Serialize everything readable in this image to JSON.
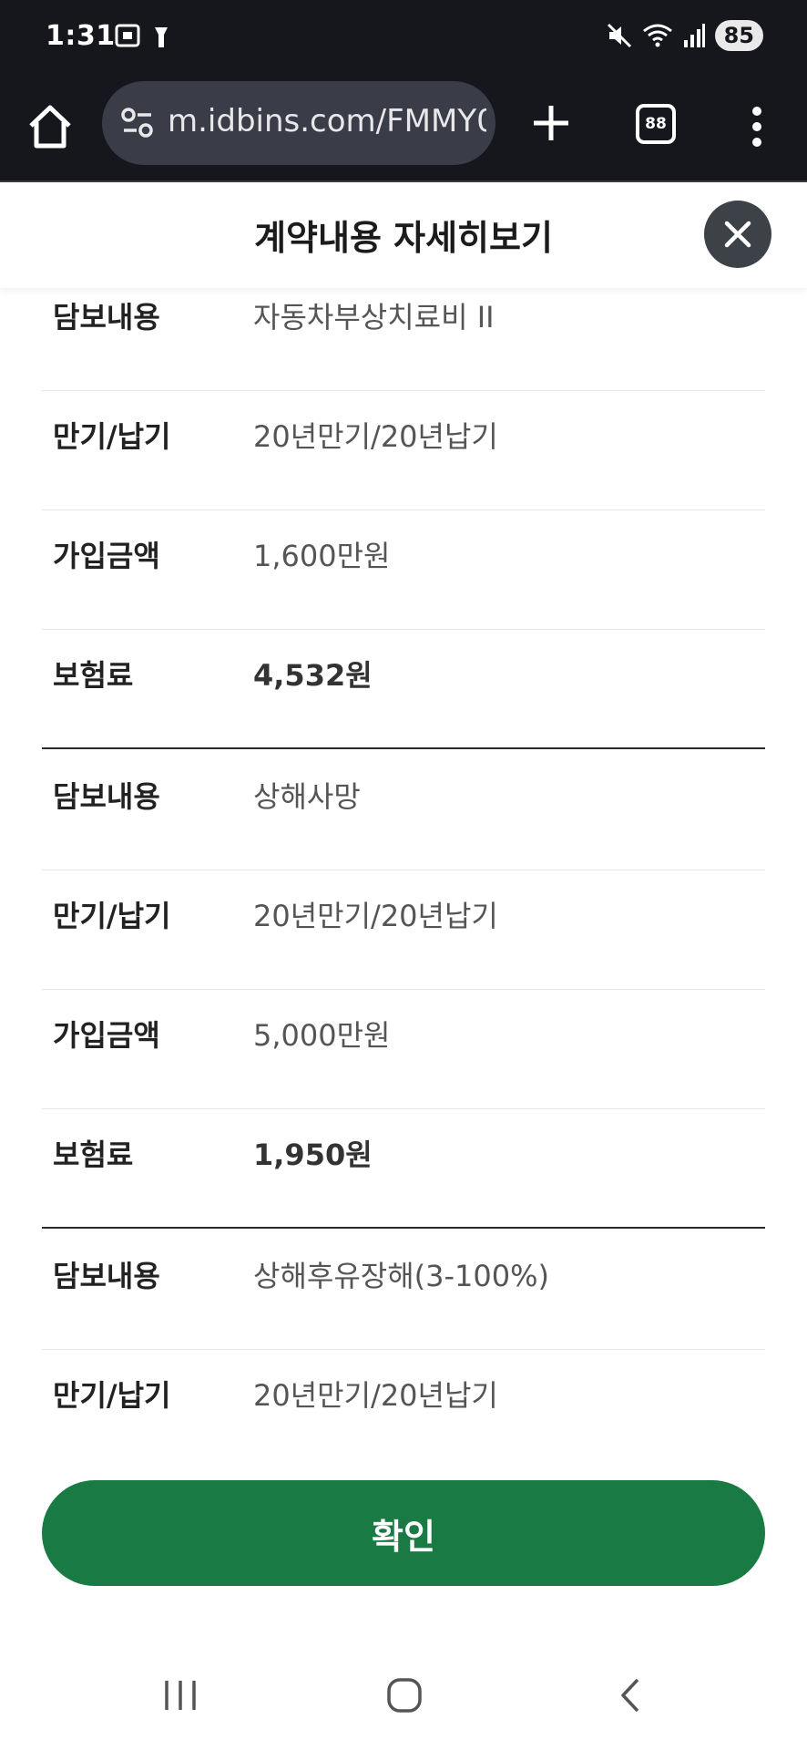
{
  "status_bar": {
    "time": "1:31",
    "battery": "85"
  },
  "browser": {
    "url": "m.idbins.com/FMMY0",
    "tab_count": "88"
  },
  "modal": {
    "title": "계약내용 자세히보기"
  },
  "coverages": [
    {
      "rows": [
        {
          "label": "담보내용",
          "value": "자동차부상치료비 II"
        },
        {
          "label": "만기/납기",
          "value": "20년만기/20년납기"
        },
        {
          "label": "가입금액",
          "value": "1,600만원"
        },
        {
          "label": "보험료",
          "value": "4,532원"
        }
      ]
    },
    {
      "rows": [
        {
          "label": "담보내용",
          "value": "상해사망"
        },
        {
          "label": "만기/납기",
          "value": "20년만기/20년납기"
        },
        {
          "label": "가입금액",
          "value": "5,000만원"
        },
        {
          "label": "보험료",
          "value": "1,950원"
        }
      ]
    },
    {
      "rows": [
        {
          "label": "담보내용",
          "value": "상해후유장해(3-100%)"
        },
        {
          "label": "만기/납기",
          "value": "20년만기/20년납기"
        }
      ]
    }
  ],
  "confirm_label": "확인"
}
